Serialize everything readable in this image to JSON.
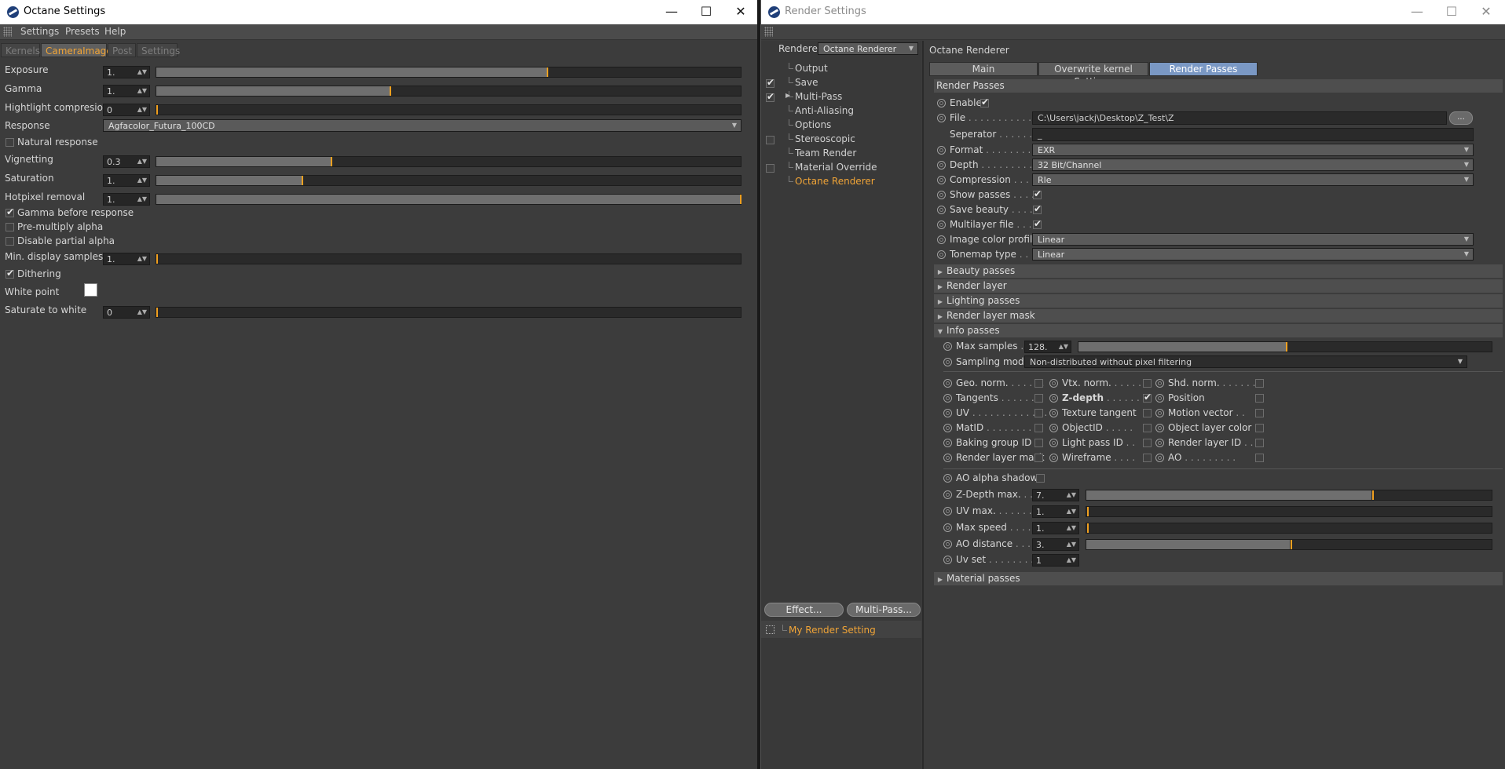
{
  "left_window": {
    "title": "Octane Settings",
    "menu": [
      "Settings",
      "Presets",
      "Help"
    ],
    "tabs": [
      "Kernels",
      "CameraImager",
      "Post",
      "Settings"
    ],
    "params": {
      "exposure": {
        "label": "Exposure",
        "value": "1.",
        "fill": 0.67
      },
      "gamma": {
        "label": "Gamma",
        "value": "1.",
        "fill": 0.4
      },
      "highlight": {
        "label": "Hightlight compresion",
        "value": "0",
        "fill": 0.0
      },
      "response": {
        "label": "Response",
        "value": "Agfacolor_Futura_100CD"
      },
      "natural_response": {
        "label": "Natural response",
        "checked": false
      },
      "vignetting": {
        "label": "Vignetting",
        "value": "0.3",
        "fill": 0.3
      },
      "saturation": {
        "label": "Saturation",
        "value": "1.",
        "fill": 0.25
      },
      "hotpixel": {
        "label": "Hotpixel removal",
        "value": "1.",
        "fill": 1.0
      },
      "gamma_before_response": {
        "label": "Gamma before response",
        "checked": true
      },
      "premultiply": {
        "label": "Pre-multiply alpha",
        "checked": false
      },
      "disable_partial": {
        "label": "Disable partial alpha",
        "checked": false
      },
      "min_samples": {
        "label": "Min. display samples",
        "value": "1.",
        "fill": 0.0
      },
      "dithering": {
        "label": "Dithering",
        "checked": true
      },
      "white_point": {
        "label": "White point",
        "color": "#ffffff"
      },
      "saturate_white": {
        "label": "Saturate to white",
        "value": "0",
        "fill": 0.0
      }
    }
  },
  "right_window": {
    "title": "Render Settings",
    "renderer_label": "Renderer",
    "renderer_value": "Octane Renderer",
    "tree": [
      {
        "label": "Output",
        "check": null
      },
      {
        "label": "Save",
        "check": true
      },
      {
        "label": "Multi-Pass",
        "check": true
      },
      {
        "label": "Anti-Aliasing",
        "check": null
      },
      {
        "label": "Options",
        "check": null
      },
      {
        "label": "Stereoscopic",
        "check": false
      },
      {
        "label": "Team Render",
        "check": null
      },
      {
        "label": "Material Override",
        "check": false
      },
      {
        "label": "Octane Renderer",
        "check": null,
        "selected": true
      }
    ],
    "effect_button": "Effect...",
    "multipass_button": "Multi-Pass...",
    "my_render_setting": "My Render Setting",
    "panel_title": "Octane Renderer",
    "tabs": [
      "Main",
      "Overwrite kernel Settings",
      "Render Passes"
    ],
    "section": "Render Passes",
    "enable": {
      "label": "Enable",
      "checked": true
    },
    "file": {
      "label": "File",
      "value": "C:\\Users\\jackj\\Desktop\\Z_Test\\Z",
      "button": "..."
    },
    "separator": {
      "label": "Seperator",
      "value": "_"
    },
    "format": {
      "label": "Format",
      "value": "EXR"
    },
    "depth": {
      "label": "Depth",
      "value": "32 Bit/Channel"
    },
    "compression": {
      "label": "Compression",
      "value": "Rle"
    },
    "show_passes": {
      "label": "Show passes",
      "checked": true
    },
    "save_beauty": {
      "label": "Save beauty",
      "checked": true
    },
    "multilayer": {
      "label": "Multilayer file",
      "checked": true
    },
    "image_color_profile": {
      "label": "Image color profile",
      "value": "Linear"
    },
    "tonemap": {
      "label": "Tonemap type",
      "value": "Linear"
    },
    "groups": [
      "Beauty passes",
      "Render layer",
      "Lighting passes",
      "Render layer mask",
      "Info passes"
    ],
    "max_samples": {
      "label": "Max samples",
      "value": "128.",
      "fill": 0.5
    },
    "sampling_mode": {
      "label": "Sampling mode",
      "value": "Non-distributed without pixel filtering"
    },
    "passes": [
      [
        {
          "label": "Geo. norm.",
          "checked": false
        },
        {
          "label": "Vtx. norm.",
          "checked": false
        },
        {
          "label": "Shd. norm.",
          "checked": false
        }
      ],
      [
        {
          "label": "Tangents",
          "checked": false
        },
        {
          "label": "Z-depth",
          "checked": true
        },
        {
          "label": "Position",
          "checked": false
        }
      ],
      [
        {
          "label": "UV",
          "checked": false
        },
        {
          "label": "Texture tangent",
          "checked": false
        },
        {
          "label": "Motion vector",
          "checked": false
        }
      ],
      [
        {
          "label": "MatID",
          "checked": false
        },
        {
          "label": "ObjectID",
          "checked": false
        },
        {
          "label": "Object layer color",
          "checked": false
        }
      ],
      [
        {
          "label": "Baking group ID",
          "checked": false
        },
        {
          "label": "Light pass ID",
          "checked": false
        },
        {
          "label": "Render layer ID",
          "checked": false
        }
      ],
      [
        {
          "label": "Render layer mask",
          "checked": false
        },
        {
          "label": "Wireframe",
          "checked": false
        },
        {
          "label": "AO",
          "checked": false
        }
      ]
    ],
    "ao_alpha_shadow": {
      "label": "AO alpha shadow",
      "checked": false
    },
    "zdepth_max": {
      "label": "Z-Depth max.",
      "value": "7.",
      "fill": 0.7
    },
    "uv_max": {
      "label": "UV max.",
      "value": "1.",
      "fill": 0.0
    },
    "max_speed": {
      "label": "Max speed",
      "value": "1.",
      "fill": 0.0
    },
    "ao_distance": {
      "label": "AO distance",
      "value": "3.",
      "fill": 0.5
    },
    "uv_set": {
      "label": "Uv set",
      "value": "1"
    },
    "material_passes": "Material passes"
  },
  "colors": {
    "accent": "#f0a437",
    "tab_active": "#7a98c4"
  }
}
